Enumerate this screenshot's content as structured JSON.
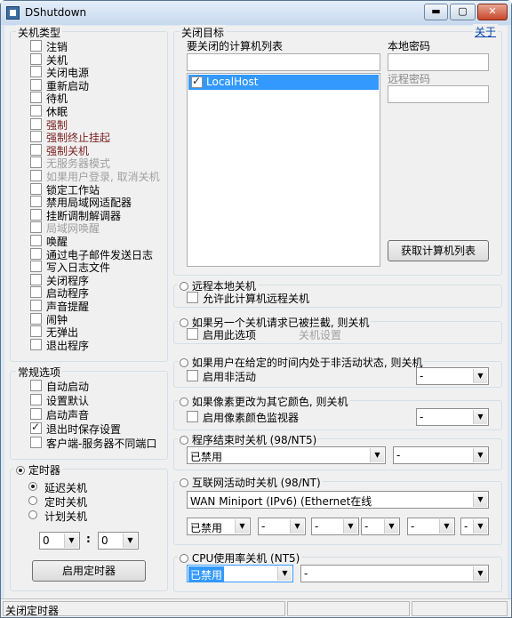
{
  "window": {
    "title": "DShutdown",
    "minimize": "▬",
    "maximize": "▢",
    "close": "✕"
  },
  "shutdown_type": {
    "legend": "关机类型",
    "items": [
      {
        "label": "注销",
        "state": "normal"
      },
      {
        "label": "关机",
        "state": "normal"
      },
      {
        "label": "关闭电源",
        "state": "normal"
      },
      {
        "label": "重新启动",
        "state": "normal"
      },
      {
        "label": "待机",
        "state": "normal"
      },
      {
        "label": "休眠",
        "state": "normal"
      },
      {
        "label": "强制",
        "state": "red"
      },
      {
        "label": "强制终止挂起",
        "state": "red"
      },
      {
        "label": "强制关机",
        "state": "red"
      },
      {
        "label": "无服务器模式",
        "state": "disabled"
      },
      {
        "label": "如果用户登录, 取消关机",
        "state": "disabled"
      },
      {
        "label": "锁定工作站",
        "state": "normal"
      },
      {
        "label": "禁用局域网适配器",
        "state": "normal"
      },
      {
        "label": "挂断调制解调器",
        "state": "normal"
      },
      {
        "label": "局域网唤醒",
        "state": "disabled"
      },
      {
        "label": "唤醒",
        "state": "normal"
      },
      {
        "label": "通过电子邮件发送日志",
        "state": "normal"
      },
      {
        "label": "写入日志文件",
        "state": "normal"
      },
      {
        "label": "关闭程序",
        "state": "normal"
      },
      {
        "label": "启动程序",
        "state": "normal"
      },
      {
        "label": "声音提醒",
        "state": "normal"
      },
      {
        "label": "闹钟",
        "state": "normal"
      },
      {
        "label": "无弹出",
        "state": "normal"
      },
      {
        "label": "退出程序",
        "state": "normal"
      }
    ]
  },
  "general": {
    "legend": "常规选项",
    "items": [
      {
        "label": "自动启动",
        "checked": false
      },
      {
        "label": "设置默认",
        "checked": false
      },
      {
        "label": "启动声音",
        "checked": false
      },
      {
        "label": "退出时保存设置",
        "checked": true
      },
      {
        "label": "客户端-服务器不同端口",
        "checked": false
      }
    ]
  },
  "timer": {
    "legend": "定时器",
    "options": [
      {
        "label": "延迟关机",
        "selected": true
      },
      {
        "label": "定时关机",
        "selected": false
      },
      {
        "label": "计划关机",
        "selected": false
      }
    ],
    "hour": "0",
    "sep": ":",
    "minute": "0",
    "start_button": "启用定时器"
  },
  "target": {
    "legend": "关闭目标",
    "about": "关于",
    "list_label": "要关闭的计算机列表",
    "host": "LocalHost",
    "local_pwd": "本地密码",
    "remote_pwd": "远程密码",
    "get_list_button": "获取计算机列表"
  },
  "remote": {
    "legend": "远程本地关机",
    "allow": "允许此计算机远程关机"
  },
  "blocked": {
    "legend": "如果另一个关机请求已被拦截, 则关机",
    "option": "启用此选项",
    "note": "关机设置"
  },
  "inactive": {
    "legend": "如果用户在给定的时间内处于非活动状态, 则关机",
    "option": "启用非活动",
    "value": "-"
  },
  "pixel": {
    "legend": "如果像素更改为其它颜色, 则关机",
    "option": "启用像素颜色监视器",
    "value": "-"
  },
  "process": {
    "legend": "程序结束时关机 (98/NT5)",
    "value": "已禁用",
    "value2": "-"
  },
  "internet": {
    "legend": "互联网活动时关机 (98/NT)",
    "adapter": "WAN Miniport (IPv6) (Ethernet在线",
    "mode": "已禁用",
    "dash": "-"
  },
  "cpu": {
    "legend": "CPU使用率关机 (NT5)",
    "value": "已禁用",
    "value2": "-"
  },
  "status": {
    "text": "关闭定时器"
  }
}
